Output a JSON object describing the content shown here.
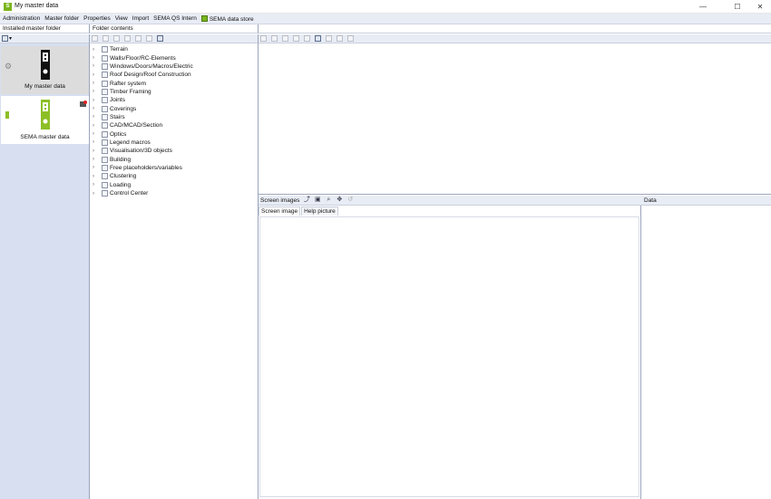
{
  "window": {
    "title": "My master data",
    "app_icon_letter": "S",
    "controls": {
      "minimize": "—",
      "maximize": "☐",
      "close": "✕"
    }
  },
  "menu": {
    "items": [
      "Administration",
      "Master folder",
      "Properties",
      "View",
      "Import",
      "SEMA QS Intern"
    ],
    "store_label": "SEMA data store"
  },
  "left_panel": {
    "header": "Installed master folder",
    "toolbar_dropdown_glyph": "▾",
    "folders": [
      {
        "label": "My master data",
        "selected": true,
        "color": "#111111"
      },
      {
        "label": "SEMA master data",
        "selected": false,
        "color": "#8cbf26"
      }
    ]
  },
  "tree_panel": {
    "header": "Folder contents",
    "chevron_glyph": "›",
    "items": [
      "Terrain",
      "Walls/Floor/RC-Elements",
      "Windows/Doors/Macros/Electric",
      "Roof Design/Roof Construction",
      "Rafter system",
      "Timber Framing",
      "Joints",
      "Coverings",
      "Stairs",
      "CAD/MCAD/Section",
      "Optics",
      "Legend macros",
      "Visualisation/3D objects",
      "Building",
      "Free placeholders/variables",
      "Clustering",
      "Loading",
      "Control Center"
    ]
  },
  "images_panel": {
    "title": "Screen images",
    "tabs": [
      "Screen image",
      "Help picture"
    ],
    "header_icons": [
      "pick-icon",
      "fit-icon",
      "zoom-icon",
      "move-icon",
      "reset-icon"
    ]
  },
  "data_panel": {
    "title": "Data"
  },
  "colors": {
    "menubar": "#e8ecf5",
    "left_panel_bg": "#d7dff0",
    "accent_green": "#7ab51d"
  }
}
